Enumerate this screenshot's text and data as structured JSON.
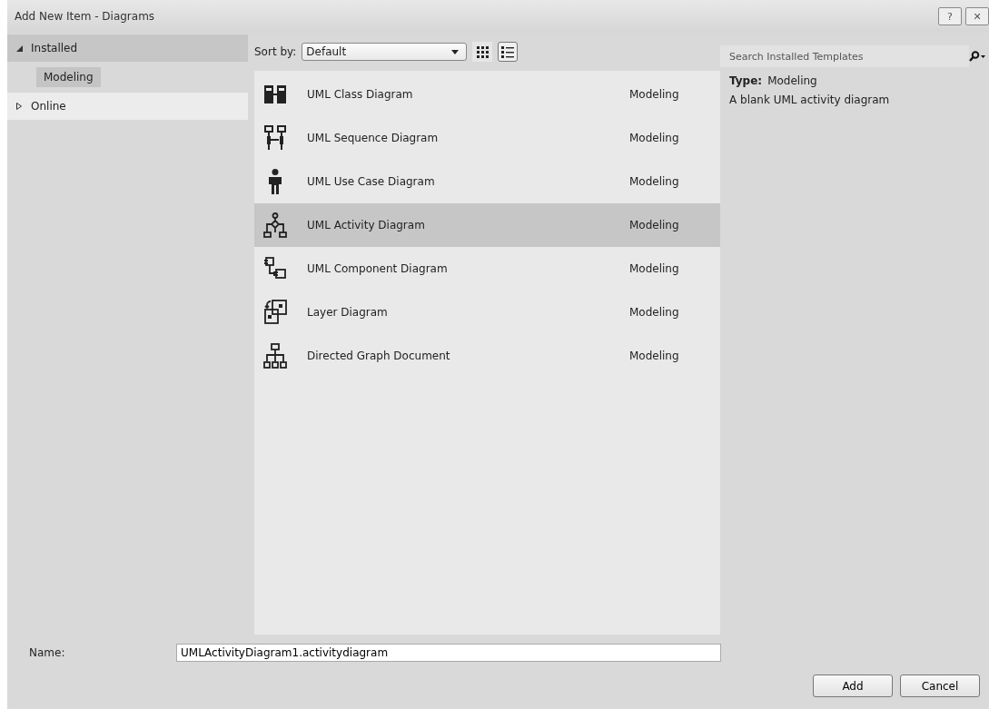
{
  "window": {
    "title": "Add New Item - Diagrams",
    "buttons": [
      "?",
      "✕"
    ]
  },
  "tree": [
    {
      "label": "Installed",
      "expanded": true,
      "selected": false,
      "children": [
        {
          "label": "Modeling",
          "selected": true
        }
      ]
    },
    {
      "label": "Online",
      "expanded": false,
      "selected": false
    }
  ],
  "sort": {
    "label": "Sort by:",
    "value": "Default"
  },
  "view_buttons": [
    {
      "kind": "grid",
      "selected": false
    },
    {
      "kind": "list",
      "selected": true
    }
  ],
  "templates": [
    {
      "kind": "class",
      "name": "UML Class Diagram",
      "category": "Modeling",
      "selected": false
    },
    {
      "kind": "sequence",
      "name": "UML Sequence Diagram",
      "category": "Modeling",
      "selected": false
    },
    {
      "kind": "usecase",
      "name": "UML Use Case Diagram",
      "category": "Modeling",
      "selected": false
    },
    {
      "kind": "activity",
      "name": "UML Activity Diagram",
      "category": "Modeling",
      "selected": true
    },
    {
      "kind": "component",
      "name": "UML Component Diagram",
      "category": "Modeling",
      "selected": false
    },
    {
      "kind": "layer",
      "name": "Layer Diagram",
      "category": "Modeling",
      "selected": false
    },
    {
      "kind": "graph",
      "name": "Directed Graph Document",
      "category": "Modeling",
      "selected": false
    }
  ],
  "search": {
    "placeholder": "Search Installed Templates"
  },
  "details": {
    "type_label": "Type:",
    "type_value": "Modeling",
    "description": "A blank UML activity diagram"
  },
  "name_field": {
    "label": "Name:",
    "value": "UMLActivityDiagram1.activitydiagram"
  },
  "buttons": [
    "Add",
    "Cancel"
  ]
}
